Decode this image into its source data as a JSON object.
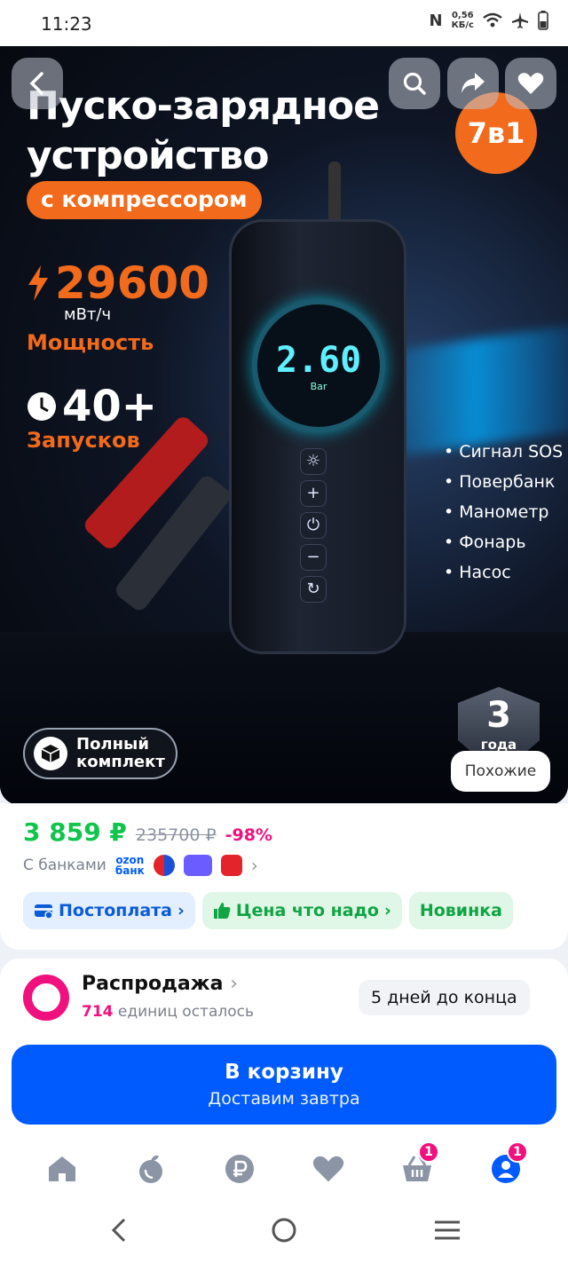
{
  "status_bar": {
    "time": "11:23",
    "speed_value": "0,56",
    "speed_unit": "КБ/с"
  },
  "hero": {
    "title_line1": "Пуско-зарядное",
    "title_line2": "устройство",
    "subtitle_pill": "с компрессором",
    "badge_7in1": "7в1",
    "capacity_value": "29600",
    "capacity_unit": "мВт/ч",
    "capacity_caption": "Мощность",
    "starts_value": "40+",
    "starts_caption": "Запусков",
    "device_display": "2.60",
    "device_display_unit": "Bar",
    "features": [
      "Сигнал SOS",
      "Повербанк",
      "Манометр",
      "Фонарь",
      "Насос"
    ],
    "warranty_number": "3",
    "warranty_label": "года",
    "full_set_line1": "Полный",
    "full_set_line2": "комплект",
    "similar_button": "Похожие"
  },
  "product": {
    "price": "3 859 ₽",
    "old_price": "235700 ₽",
    "discount": "-98%",
    "banks_label": "С банками",
    "ozon_bank_line1": "ozon",
    "ozon_bank_line2": "банк",
    "chips": [
      {
        "label": "Постоплата"
      },
      {
        "label": "Цена что надо"
      },
      {
        "label": "Новинка"
      }
    ]
  },
  "sale": {
    "title": "Распродажа",
    "count": "714",
    "remaining_text": "единиц осталось",
    "days_left": "5 дней до конца"
  },
  "cart_button": {
    "label": "В корзину",
    "sub_label": "Доставим завтра"
  },
  "bottom_nav": {
    "cart_badge": "1",
    "profile_badge": "1"
  },
  "colors": {
    "brand_blue": "#005bff",
    "price_green": "#10c44c",
    "accent_pink": "#f1117e",
    "orange": "#f26a1b"
  }
}
